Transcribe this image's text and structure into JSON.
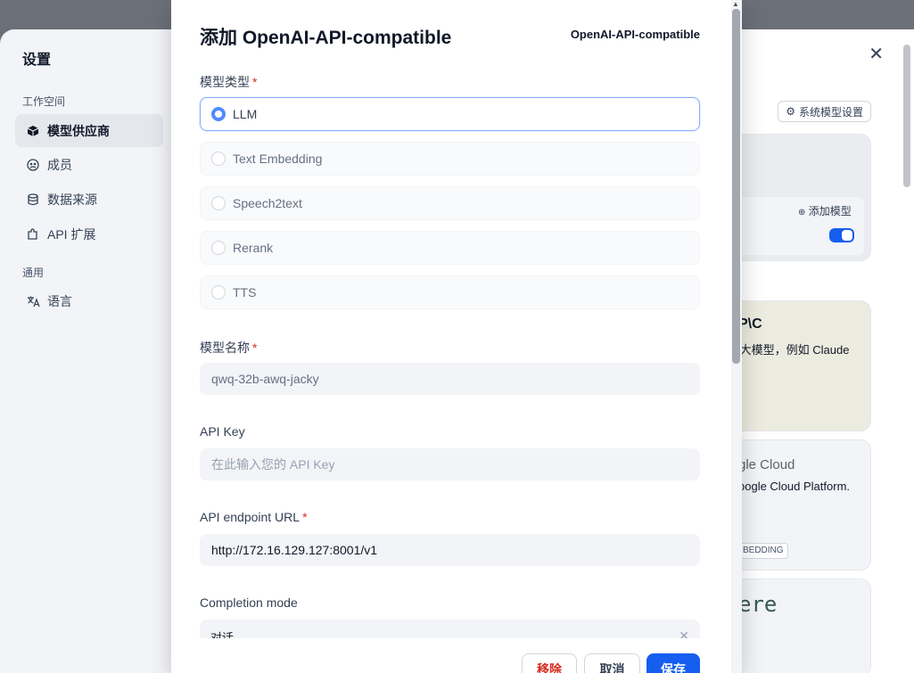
{
  "settings": {
    "title": "设置",
    "group_workspace": "工作空间",
    "group_general": "通用",
    "nav": {
      "providers": "模型供应商",
      "members": "成员",
      "data_source": "数据来源",
      "api_ext": "API 扩展",
      "language": "语言"
    },
    "system_model_btn": "系统模型设置",
    "add_model": "添加模型",
    "card2_title": "P\\C",
    "card2_desc": ":大模型，例如 Claude",
    "card3_title": "gle Cloud",
    "card3_desc": "oogle Cloud Platform.",
    "card3_tag": "BEDDING",
    "card4_title": "ere"
  },
  "modal": {
    "title": "添加 OpenAI-API-compatible",
    "provider_label": "OpenAI-API-compatible",
    "model_type_label": "模型类型",
    "required_mark": "*",
    "model_types": [
      "LLM",
      "Text Embedding",
      "Speech2text",
      "Rerank",
      "TTS"
    ],
    "selected_model_type": "LLM",
    "model_name_label": "模型名称",
    "model_name_value": "qwq-32b-awq-jacky",
    "api_key_label": "API Key",
    "api_key_placeholder": "在此输入您的 API Key",
    "endpoint_label": "API endpoint URL",
    "endpoint_value": "http://172.16.129.127:8001/v1",
    "completion_label": "Completion mode",
    "completion_value": "对话",
    "buttons": {
      "remove": "移除",
      "cancel": "取消",
      "save": "保存"
    }
  },
  "colors": {
    "accent": "#155eef",
    "danger": "#d92d20",
    "selected_border": "#84adff"
  },
  "icons": [
    "cube-icon",
    "members-icon",
    "database-icon",
    "puzzle-icon",
    "translate-icon",
    "close-icon",
    "gear-icon",
    "plus-circle-icon"
  ]
}
